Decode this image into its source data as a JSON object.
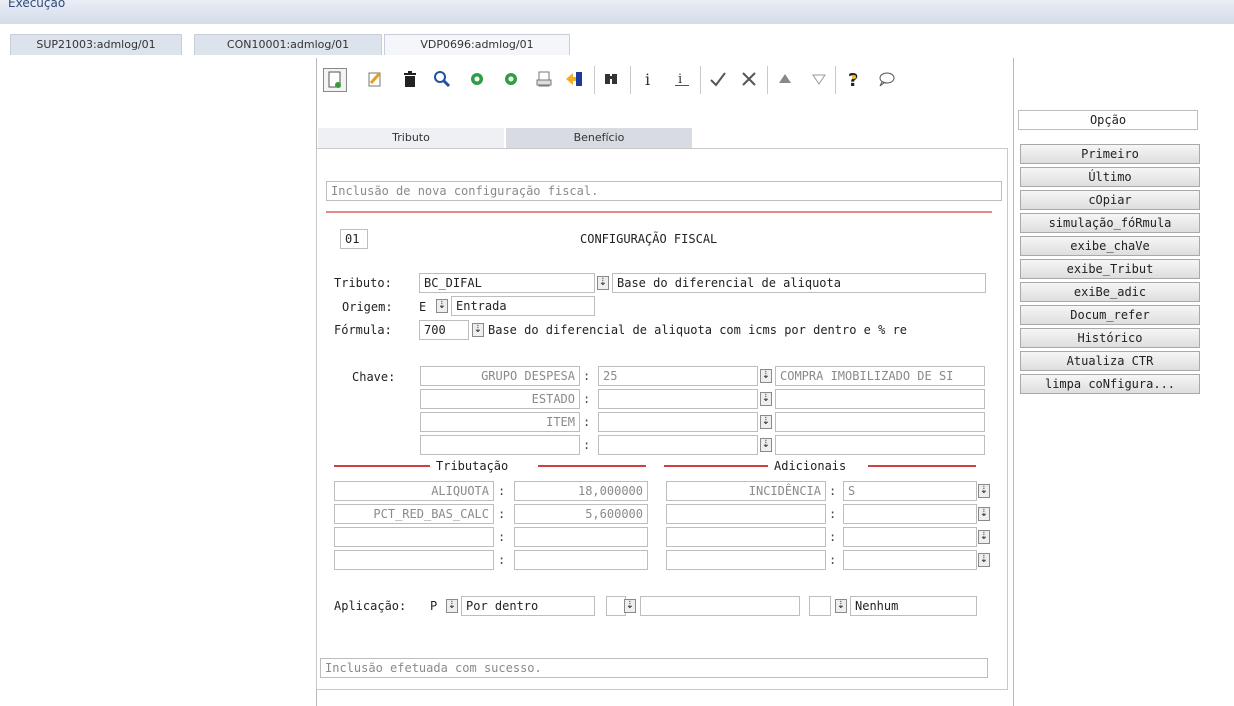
{
  "app": {
    "title": "Execução"
  },
  "window_tabs": [
    "SUP21003:admlog/01",
    "CON10001:admlog/01",
    "VDP0696:admlog/01"
  ],
  "sub_tabs": [
    "Tributo",
    "Benefício"
  ],
  "form": {
    "message": "Inclusão de nova configuração fiscal.",
    "code": "01",
    "heading": "CONFIGURAÇÃO FISCAL",
    "tributo_label": "Tributo:",
    "tributo_code": "BC_DIFAL",
    "tributo_desc": "Base do diferencial de aliquota",
    "origem_label": "Origem:",
    "origem_code": "E",
    "origem_desc": "Entrada",
    "formula_label": "Fórmula:",
    "formula_code": "700",
    "formula_desc": "Base do diferencial de aliquota com icms por dentro e % re",
    "chave_label": "Chave:",
    "chave_rows": [
      {
        "name": "GRUPO DESPESA",
        "value": "25",
        "desc": "COMPRA IMOBILIZADO DE SI"
      },
      {
        "name": "ESTADO",
        "value": "",
        "desc": ""
      },
      {
        "name": "ITEM",
        "value": "",
        "desc": ""
      },
      {
        "name": "",
        "value": "",
        "desc": ""
      }
    ],
    "tributacao_title": "Tributação",
    "adicionais_title": "Adicionais",
    "tributacao_rows": [
      {
        "name": "ALIQUOTA",
        "value": "18,000000"
      },
      {
        "name": "PCT_RED_BAS_CALC",
        "value": "5,600000"
      },
      {
        "name": "",
        "value": ""
      },
      {
        "name": "",
        "value": ""
      }
    ],
    "adicionais_rows": [
      {
        "name": "INCIDÊNCIA",
        "value": "S"
      },
      {
        "name": "",
        "value": ""
      },
      {
        "name": "",
        "value": ""
      },
      {
        "name": "",
        "value": ""
      }
    ],
    "aplicacao_label": "Aplicação:",
    "aplicacao_code": "P",
    "aplicacao_desc": "Por dentro",
    "aplicacao_extra": "",
    "nenhum": "Nenhum",
    "status": "Inclusão efetuada com sucesso."
  },
  "options": {
    "title": "Opção",
    "buttons": [
      "Primeiro",
      "Último",
      "cOpiar",
      "simulação_fóRmula",
      "exibe_chaVe",
      "exibe_Tribut",
      "exiBe_adic",
      "Docum_refer",
      "Histórico",
      "Atualiza CTR",
      "limpa coNfigura..."
    ]
  },
  "toolbar_icons": [
    "new-icon",
    "edit-icon",
    "delete-icon",
    "search-icon",
    "next-icon",
    "previous-icon",
    "print-icon",
    "exit-icon",
    "find-icon",
    "info-icon",
    "info-alt-icon",
    "confirm-icon",
    "cancel-icon",
    "up-icon",
    "down-icon",
    "help-icon",
    "chat-icon"
  ],
  "colors": {
    "accent": "#d04040",
    "header": "#304a7a"
  }
}
